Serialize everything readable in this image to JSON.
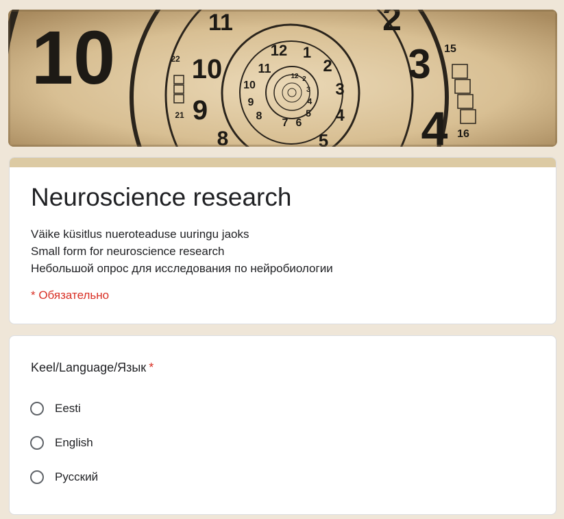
{
  "header": {
    "image_name": "spiral-clock-header-image"
  },
  "form": {
    "title": "Neuroscience research",
    "description": [
      "Väike küsitlus nueroteaduse uuringu jaoks",
      "Small form for neuroscience research",
      "Небольшой опрос для исследования по нейробиологии"
    ],
    "required_note": "* Обязательно"
  },
  "question": {
    "title": "Keel/Language/Язык",
    "required_mark": "*",
    "options": [
      {
        "label": "Eesti",
        "selected": false
      },
      {
        "label": "English",
        "selected": false
      },
      {
        "label": "Русский",
        "selected": false
      }
    ]
  },
  "colors": {
    "page_background": "#efe6d8",
    "card_accent": "#dccaa3",
    "required": "#d93025",
    "text": "#202124",
    "radio_border": "#5f6368"
  }
}
